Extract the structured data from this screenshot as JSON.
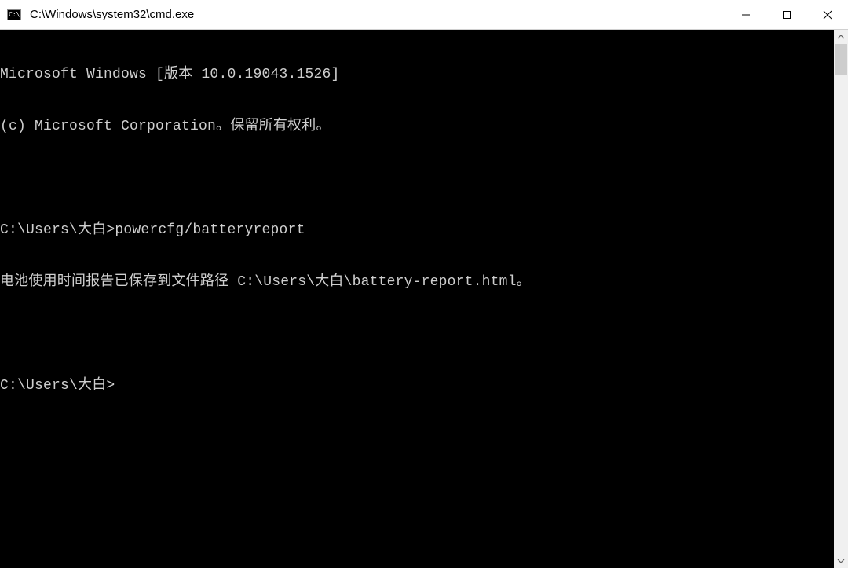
{
  "titlebar": {
    "icon_label": "C:\\",
    "title": "C:\\Windows\\system32\\cmd.exe"
  },
  "terminal": {
    "lines": [
      "Microsoft Windows [版本 10.0.19043.1526]",
      "(c) Microsoft Corporation。保留所有权利。",
      "",
      "C:\\Users\\大白>powercfg/batteryreport",
      "电池使用时间报告已保存到文件路径 C:\\Users\\大白\\battery-report.html。",
      "",
      "C:\\Users\\大白>"
    ]
  }
}
